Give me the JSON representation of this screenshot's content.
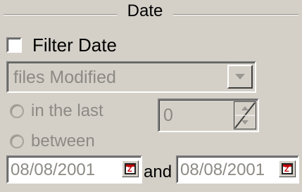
{
  "group": {
    "title": "Date"
  },
  "filter": {
    "label": "Filter Date",
    "checked": false
  },
  "modified_select": {
    "value": "files Modified"
  },
  "radio_last": {
    "label": "in the last",
    "selected": false
  },
  "spin": {
    "value": "0"
  },
  "radio_between": {
    "label": "between",
    "selected": false
  },
  "date_range": {
    "start": "08/08/2001",
    "and_label": "and",
    "end": "08/08/2001"
  },
  "colors": {
    "background": "#d4d0c8",
    "disabled_text": "#8c8a84"
  },
  "icons": {
    "dropdown": "chevron-down-icon",
    "spinner": "spin-arrows-icon",
    "calendar": "calendar-icon"
  }
}
